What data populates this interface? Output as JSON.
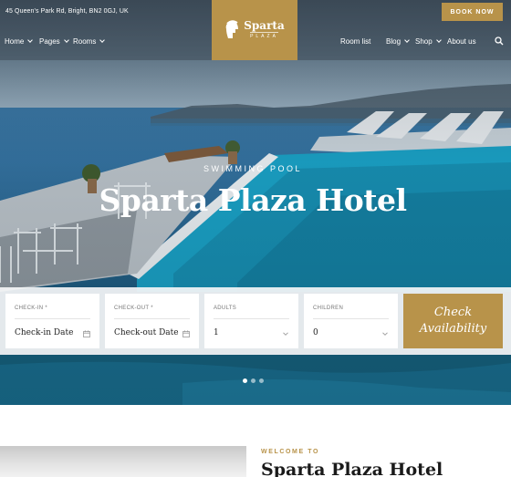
{
  "header": {
    "address": "45 Queen's Park Rd, Bright, BN2 0GJ, UK",
    "book_now": "BOOK NOW",
    "logo": {
      "name": "Sparta",
      "sub": "PLAZA"
    },
    "nav_left": [
      {
        "label": "Home",
        "has_dropdown": true
      },
      {
        "label": "Pages",
        "has_dropdown": true
      },
      {
        "label": "Rooms",
        "has_dropdown": true
      }
    ],
    "nav_right": [
      {
        "label": "Room list",
        "has_dropdown": false
      },
      {
        "label": "Blog",
        "has_dropdown": true
      },
      {
        "label": "Shop",
        "has_dropdown": true
      },
      {
        "label": "About us",
        "has_dropdown": false
      }
    ],
    "search_icon": "search-icon"
  },
  "hero": {
    "subtitle": "SWIMMING POOL",
    "title": "Sparta Plaza Hotel",
    "slides": 3,
    "active_slide": 1
  },
  "booking": {
    "checkin": {
      "label": "CHECK-IN *",
      "value": "Check-in Date",
      "icon": "calendar-icon"
    },
    "checkout": {
      "label": "CHECK-OUT *",
      "value": "Check-out Date",
      "icon": "calendar-icon"
    },
    "adults": {
      "label": "ADULTS",
      "value": "1",
      "icon": "chevron-down-icon"
    },
    "children": {
      "label": "CHILDREN",
      "value": "0",
      "icon": "chevron-down-icon"
    },
    "button": "Check Availability"
  },
  "about": {
    "welcome": "WELCOME TO",
    "title": "Sparta Plaza Hotel"
  },
  "colors": {
    "accent": "#b8934a",
    "white": "#ffffff",
    "text_dark": "#1a1a1a"
  }
}
